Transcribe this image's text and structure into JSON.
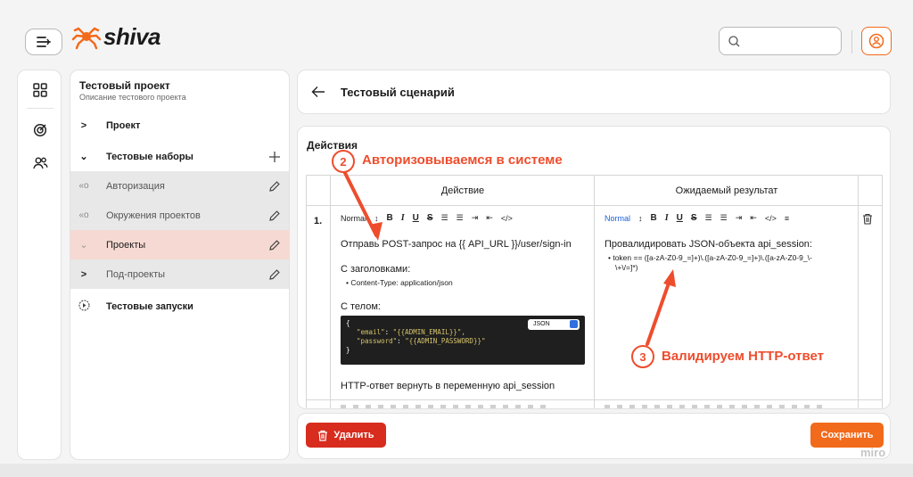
{
  "app": {
    "brand": "shiva",
    "brand_color": "#f26a1b"
  },
  "header": {
    "search_placeholder": ""
  },
  "tree": {
    "project_title": "Тестовый проект",
    "project_description": "Описание тестового проекта",
    "rows": [
      {
        "label": "Проект",
        "expanded": false
      },
      {
        "label": "Тестовые наборы",
        "expanded": true
      },
      {
        "label": "Авторизация"
      },
      {
        "label": "Окружения проектов"
      },
      {
        "label": "Проекты",
        "selected": true
      },
      {
        "label": "Под-проекты"
      },
      {
        "label": "Тестовые запуски"
      }
    ]
  },
  "scenario": {
    "title": "Тестовый сценарий"
  },
  "steps": {
    "section_title": "Действия",
    "col_action": "Действие",
    "col_expected": "Ожидаемый результат",
    "rows": [
      {
        "number": "1.",
        "action_format": "Normal",
        "action_line1": "Отправь POST-запрос на {{ API_URL }}/user/sign-in",
        "action_line2": "С заголовками:",
        "action_bullet": "Content-Type: application/json",
        "action_line3": "С телом:",
        "code_open": "{",
        "code_line1_key": "\"email\"",
        "code_line1_val": "\"{{ADMIN_EMAIL}}\",",
        "code_line2_key": "\"password\"",
        "code_line2_val": "\"{{ADMIN_PASSWORD}}\"",
        "code_close": "}",
        "code_lang": "JSON",
        "action_line4": "HTTP-ответ вернуть в переменную api_session",
        "expected_format": "Normal",
        "expected_line1": "Провалидировать JSON-объекта api_session:",
        "expected_bullet_1": "token == ([a-zA-Z0-9_=]+)\\.([a-zA-Z0-9_=]+)\\.([a-zA-Z0-9_\\-",
        "expected_bullet_2": "\\+\\/=]*)"
      }
    ]
  },
  "footer": {
    "delete_label": "Удалить",
    "save_label": "Сохранить"
  },
  "annotations": [
    {
      "number": "2",
      "text": "Авторизовываемся в системе"
    },
    {
      "number": "3",
      "text": "Валидируем HTTP-ответ"
    }
  ],
  "watermark": "miro",
  "colors": {
    "accent": "#f26a1b",
    "danger": "#d72c1e",
    "selected_row": "#f6d9d2",
    "annotation": "#ee4d2d"
  }
}
